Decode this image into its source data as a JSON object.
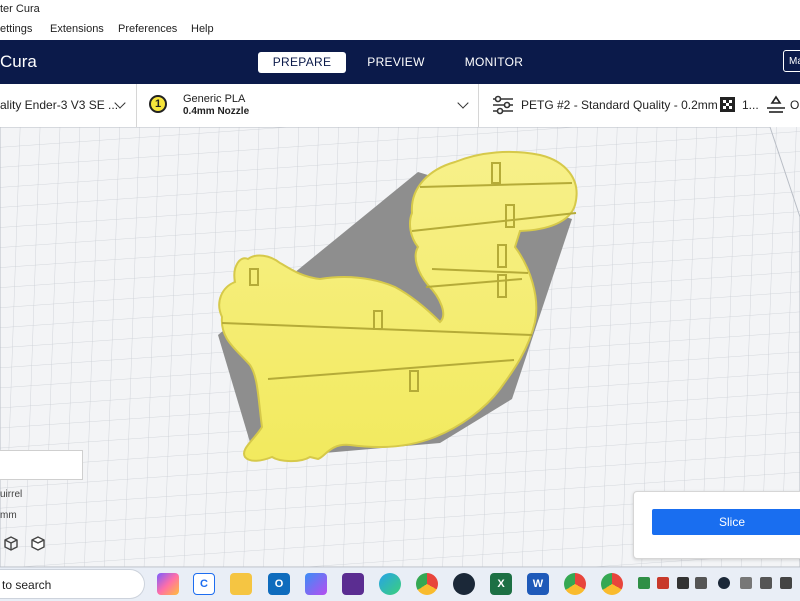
{
  "window": {
    "title": "ter Cura"
  },
  "menu": [
    "ettings",
    "Extensions",
    "Preferences",
    "Help"
  ],
  "app": {
    "name": "Cura",
    "stages": [
      {
        "label": "PREPARE",
        "active": true
      },
      {
        "label": "PREVIEW",
        "active": false
      },
      {
        "label": "MONITOR",
        "active": false
      }
    ],
    "marketplace_label": "Ma"
  },
  "toolbar": {
    "printer": "ality Ender-3 V3 SE ...",
    "extruder_number": "1",
    "material": "Generic PLA",
    "nozzle": "0.4mm Nozzle",
    "profile": "PETG #2 - Standard Quality - 0.2mm",
    "support_value": "1...",
    "adhesion_value": "O"
  },
  "object_panel": {
    "name_partial": "uirrel",
    "dims_partial": "mm"
  },
  "action_panel": {
    "slice_label": "Slice"
  },
  "taskbar": {
    "search_placeholder": "to search",
    "apps": [
      "copilot-icon",
      "cura-icon",
      "file-explorer-icon",
      "outlook-icon",
      "m365-icon",
      "clipchamp-icon",
      "edge-icon",
      "chrome-icon",
      "steam-icon",
      "excel-icon",
      "word-icon",
      "chrome-profile-icon",
      "chrome-icon-2"
    ]
  },
  "colors": {
    "appbar": "#0b1a4a",
    "model_yellow": "#f5ef72",
    "model_edge": "#d6c94a",
    "shadow_gray": "#8e8e8e",
    "slice_blue": "#196ef0"
  }
}
